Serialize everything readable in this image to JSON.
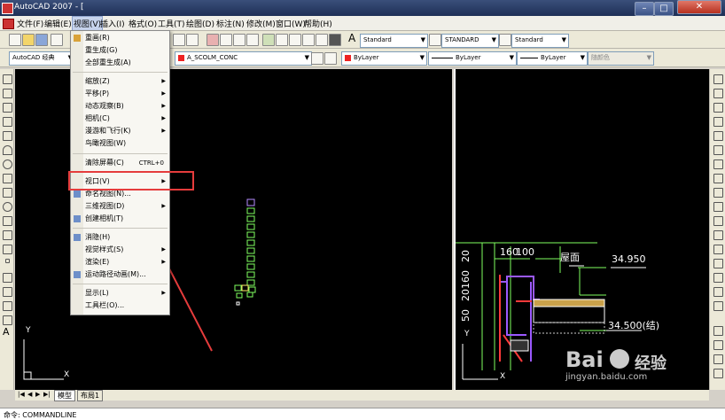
{
  "window": {
    "title": "AutoCAD 2007 - ["
  },
  "menubar": {
    "items": [
      "文件(F)",
      "编辑(E)",
      "视图(V)",
      "插入(I)",
      "格式(O)",
      "工具(T)",
      "绘图(D)",
      "标注(N)",
      "修改(M)",
      "窗口(W)",
      "帮助(H)"
    ],
    "active": "视图(V)"
  },
  "toolbar": {
    "workspace": "AutoCAD 经典",
    "text_style": "Standard",
    "dim_style": "STANDARD",
    "table_style": "Standard",
    "layer": "A_SCOLM_CONC",
    "color": "ByLayer",
    "linetype": "ByLayer",
    "lineweight": "ByLayer",
    "plotstyle": "随颜色"
  },
  "view_menu": {
    "items": [
      {
        "label": "重画(R)",
        "shortcut": "",
        "submenu": false,
        "icon": "pen-icon"
      },
      {
        "label": "重生成(G)",
        "shortcut": "",
        "submenu": false,
        "icon": ""
      },
      {
        "label": "全部重生成(A)",
        "shortcut": "",
        "submenu": false,
        "icon": ""
      },
      {
        "label": "缩放(Z)",
        "shortcut": "",
        "submenu": true,
        "icon": ""
      },
      {
        "label": "平移(P)",
        "shortcut": "",
        "submenu": true,
        "icon": ""
      },
      {
        "label": "动态观察(B)",
        "shortcut": "",
        "submenu": true,
        "icon": ""
      },
      {
        "label": "相机(C)",
        "shortcut": "",
        "submenu": true,
        "icon": ""
      },
      {
        "label": "漫游和飞行(K)",
        "shortcut": "",
        "submenu": true,
        "icon": ""
      },
      {
        "label": "鸟瞰视图(W)",
        "shortcut": "",
        "submenu": false,
        "icon": ""
      },
      {
        "label": "清除屏幕(C)",
        "shortcut": "CTRL+0",
        "submenu": false,
        "icon": ""
      },
      {
        "label": "视口(V)",
        "shortcut": "",
        "submenu": true,
        "icon": ""
      },
      {
        "label": "命名视图(N)...",
        "shortcut": "",
        "submenu": false,
        "icon": "named-view-icon"
      },
      {
        "label": "三维视图(D)",
        "shortcut": "",
        "submenu": true,
        "icon": ""
      },
      {
        "label": "创建相机(T)",
        "shortcut": "",
        "submenu": false,
        "icon": "camera-icon"
      },
      {
        "label": "消隐(H)",
        "shortcut": "",
        "submenu": false,
        "icon": "hide-icon"
      },
      {
        "label": "视觉样式(S)",
        "shortcut": "",
        "submenu": true,
        "icon": ""
      },
      {
        "label": "渲染(E)",
        "shortcut": "",
        "submenu": true,
        "icon": ""
      },
      {
        "label": "运动路径动画(M)...",
        "shortcut": "",
        "submenu": false,
        "icon": "motion-path-icon"
      },
      {
        "label": "显示(L)",
        "shortcut": "",
        "submenu": true,
        "icon": ""
      },
      {
        "label": "工具栏(O)...",
        "shortcut": "",
        "submenu": false,
        "icon": ""
      }
    ]
  },
  "drawing": {
    "dim_160": "160",
    "dim_100": "100",
    "dim_20": "20",
    "dim_20160": "20160",
    "dim_50": "50",
    "label_roof": "屋面",
    "elev_1": "34.950",
    "elev_2": "34.500(结)"
  },
  "ucs": {
    "x": "X",
    "y": "Y"
  },
  "tabs": {
    "model": "模型",
    "layout": "布局1"
  },
  "command": {
    "prompt": "命令: COMMANDLINE"
  },
  "watermark": {
    "brand": "Bai",
    "brand2": "经验",
    "url": "jingyan.baidu.com"
  },
  "colors": {
    "highlight": "#e53c3c",
    "menu_active": "#c6d3ec",
    "cad_bg": "#000000"
  }
}
